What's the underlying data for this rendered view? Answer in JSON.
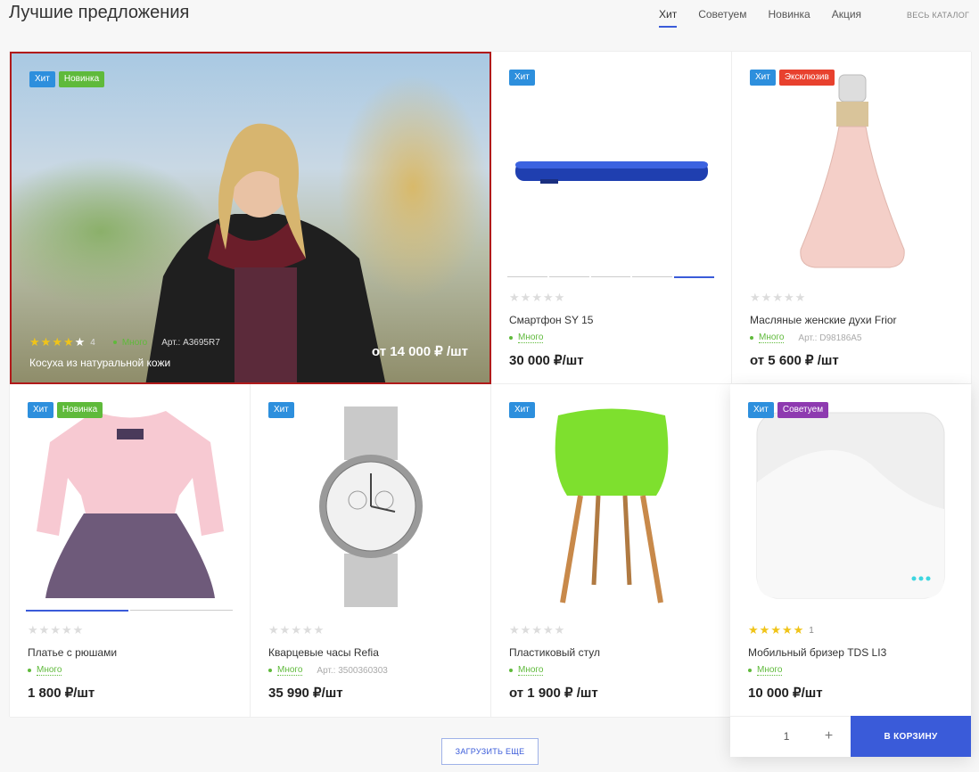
{
  "header": {
    "title": "Лучшие предложения",
    "tabs": [
      "Хит",
      "Советуем",
      "Новинка",
      "Акция"
    ],
    "catalog_link": "ВЕСЬ КАТАЛОГ"
  },
  "products": [
    {
      "badges": [
        "Хит",
        "Новинка"
      ],
      "rating": 4,
      "reviews": "4",
      "stock": "Много",
      "article": "Арт.: А3695R7",
      "name": "Косуха из натуральной кожи",
      "price": "от 14 000 ₽ /шт"
    },
    {
      "badges": [
        "Хит"
      ],
      "rating": 0,
      "name": "Смартфон SY 15",
      "stock": "Много",
      "price": "30 000 ₽/шт"
    },
    {
      "badges": [
        "Хит",
        "Эксклюзив"
      ],
      "rating": 0,
      "name": "Масляные женские духи Frior",
      "stock": "Много",
      "article": "Арт.: D98186A5",
      "price": "от 5 600 ₽ /шт"
    },
    {
      "badges": [
        "Хит",
        "Новинка"
      ],
      "rating": 0,
      "name": "Платье с рюшами",
      "stock": "Много",
      "price": "1 800 ₽/шт"
    },
    {
      "badges": [
        "Хит"
      ],
      "rating": 0,
      "name": "Кварцевые часы Refia",
      "stock": "Много",
      "article": "Арт.: 3500360303",
      "price": "35 990 ₽/шт"
    },
    {
      "badges": [
        "Хит"
      ],
      "rating": 0,
      "name": "Пластиковый стул",
      "stock": "Много",
      "price": "от 1 900 ₽ /шт"
    },
    {
      "badges": [
        "Хит",
        "Советуем"
      ],
      "rating": 5,
      "reviews": "1",
      "name": "Мобильный бризер TDS LI3",
      "stock": "Много",
      "price": "10 000 ₽/шт",
      "qty": "1",
      "qty_plus": "+",
      "cart": "В КОРЗИНУ"
    }
  ],
  "load_more": "ЗАГРУЗИТЬ ЕЩЕ",
  "colors": {
    "accent": "#3a5bd9",
    "hit": "#2d8fdd",
    "new": "#5fba3b",
    "exclusive": "#e8412e",
    "recommend": "#8e3ab0"
  }
}
